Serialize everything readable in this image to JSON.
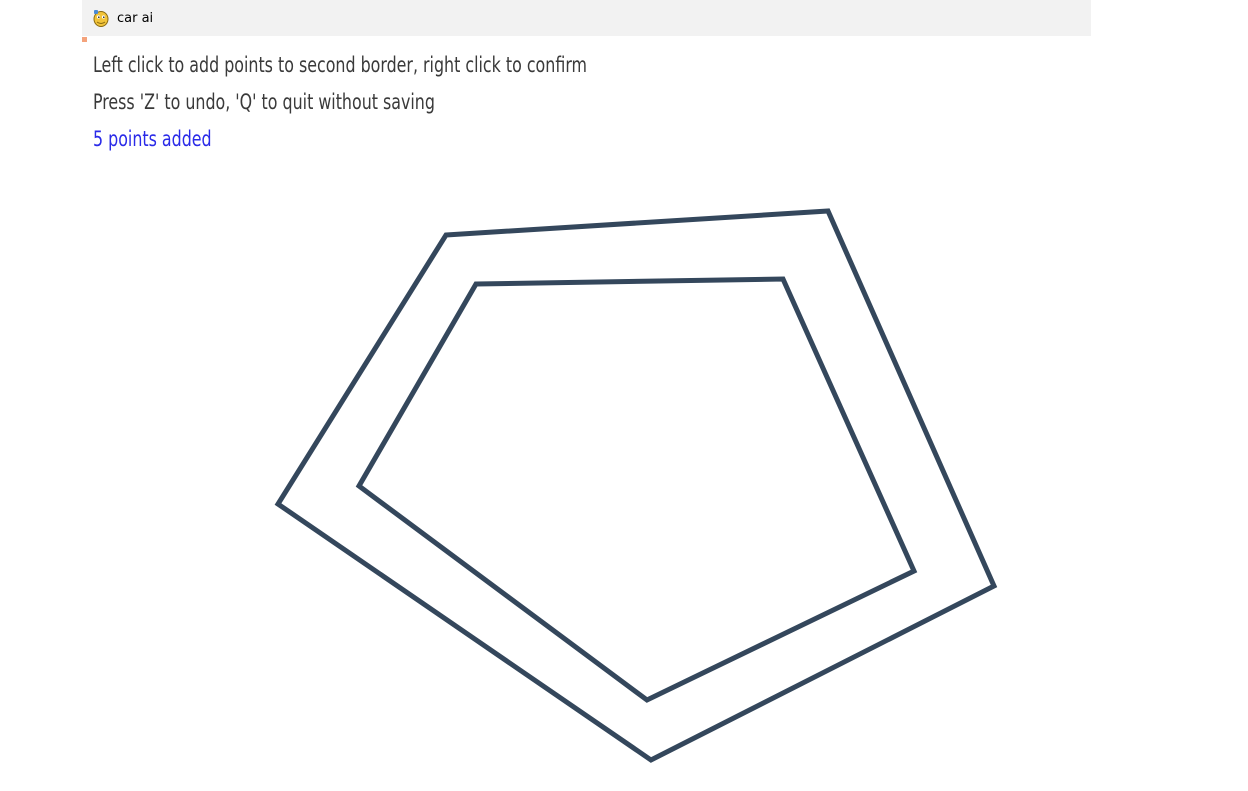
{
  "window": {
    "title": "car ai",
    "icon": "pygame-snake-icon"
  },
  "instructions": {
    "line1": "Left click to add points to second border, right click to confirm",
    "line2": "Press 'Z' to undo, 'Q' to quit without saving",
    "status": "5 points added"
  },
  "colors": {
    "border_stroke": "#34475c",
    "status_text": "#2a2ae8",
    "instruction_text": "#3a3a3a",
    "titlebar_bg": "#f2f2f2"
  }
}
